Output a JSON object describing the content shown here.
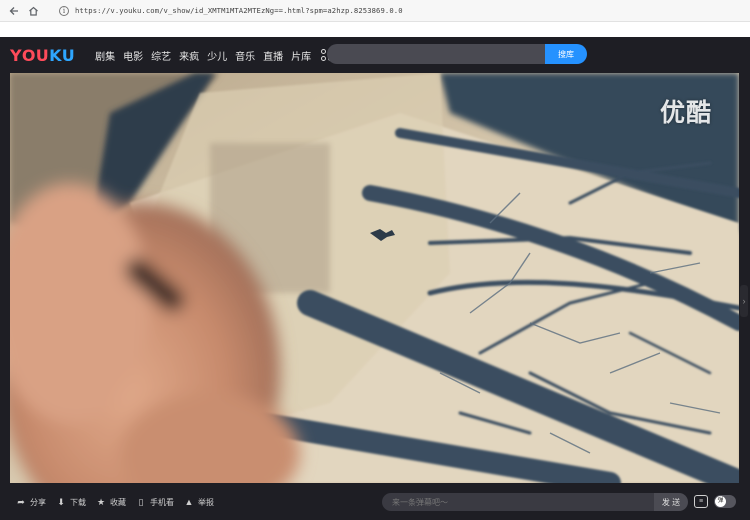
{
  "browser": {
    "back_icon": "back-arrow-icon",
    "home_icon": "home-icon",
    "info_glyph": "i",
    "url": "https://v.youku.com/v_show/id_XMTM1MTA2MTEzNg==.html?spm=a2hzp.8253869.0.0"
  },
  "header": {
    "logo": {
      "y": "Y",
      "o": "O",
      "u": "U",
      "k": "K",
      "u2": "U"
    },
    "nav": [
      "剧集",
      "电影",
      "综艺",
      "来疯",
      "少儿",
      "音乐",
      "直播",
      "片库"
    ],
    "apps_icon": "apps-grid-icon",
    "search": {
      "placeholder": "",
      "button_label": "搜库"
    }
  },
  "player": {
    "watermark": "优酷",
    "side_arrow": "›"
  },
  "bottom_bar": {
    "actions": [
      {
        "icon": "share-icon",
        "glyph": "➦",
        "label": "分享"
      },
      {
        "icon": "download-icon",
        "glyph": "⬇",
        "label": "下载"
      },
      {
        "icon": "favorite-star-icon",
        "glyph": "★",
        "label": "收藏"
      },
      {
        "icon": "phone-icon",
        "glyph": "▯",
        "label": "手机看"
      },
      {
        "icon": "warning-icon",
        "glyph": "▲",
        "label": "举报"
      }
    ],
    "danmu": {
      "placeholder": "来一条弹幕吧～",
      "send_label": "发 送",
      "settings_glyph": "≡",
      "toggle_glyph": "弹"
    }
  },
  "colors": {
    "background": "#1e1e24",
    "accent_blue": "#2592ff",
    "logo_red": "#ff4b5a",
    "logo_blue": "#2ea6ff"
  }
}
